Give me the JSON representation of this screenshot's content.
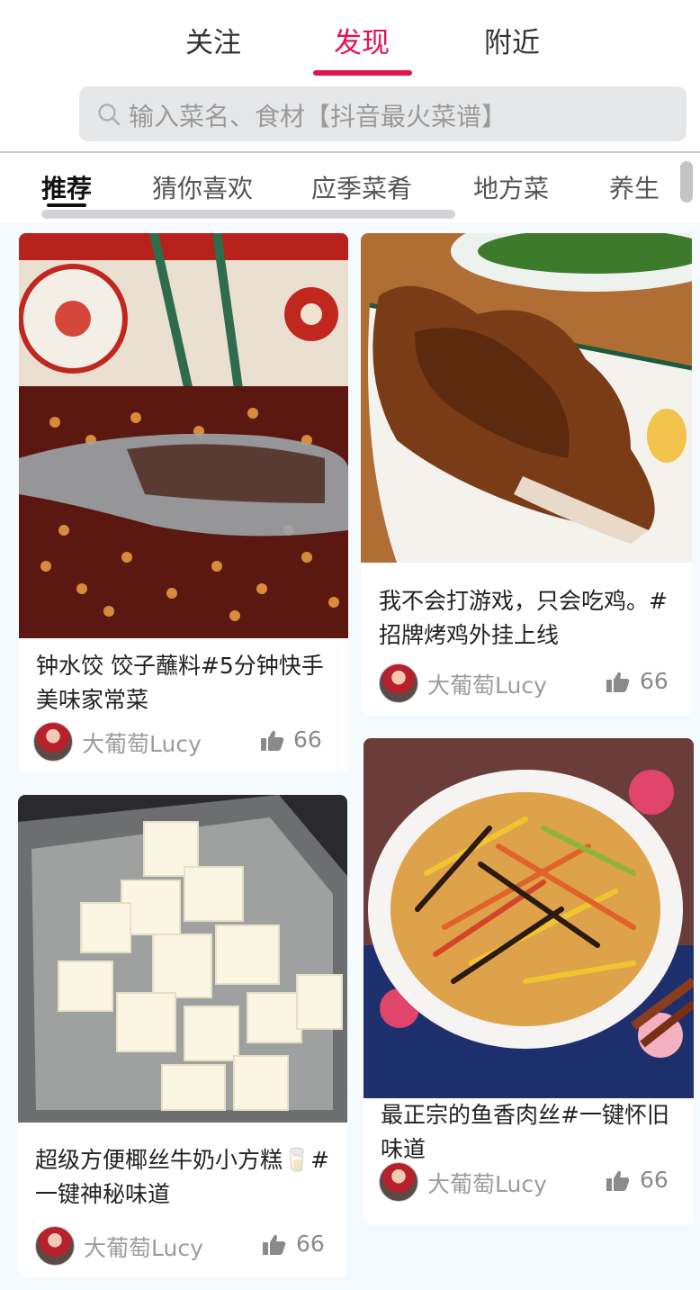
{
  "top_tabs": [
    "关注",
    "发现",
    "附近"
  ],
  "active_top_tab": "发现",
  "search": {
    "placeholder": "输入菜名、食材【抖音最火菜谱】"
  },
  "categories": [
    "推荐",
    "猜你喜欢",
    "应季菜肴",
    "地方菜",
    "养生"
  ],
  "active_category": "推荐",
  "colors": {
    "accent": "#e4124f",
    "search_bg": "#e6e7e9",
    "feed_bg": "#f4fafd"
  },
  "recipes": [
    {
      "title": "钟水饺 饺子蘸料#5分钟快手美味家常菜",
      "author": "大葡萄Lucy",
      "likes": "66"
    },
    {
      "title": "我不会打游戏，只会吃鸡。#招牌烤鸡外挂上线",
      "author": "大葡萄Lucy",
      "likes": "66"
    },
    {
      "title": "超级方便椰丝牛奶小方糕🥛#一键神秘味道",
      "author": "大葡萄Lucy",
      "likes": "66"
    },
    {
      "title": "最正宗的鱼香肉丝#一键怀旧味道",
      "author": "大葡萄Lucy",
      "likes": "66"
    }
  ]
}
